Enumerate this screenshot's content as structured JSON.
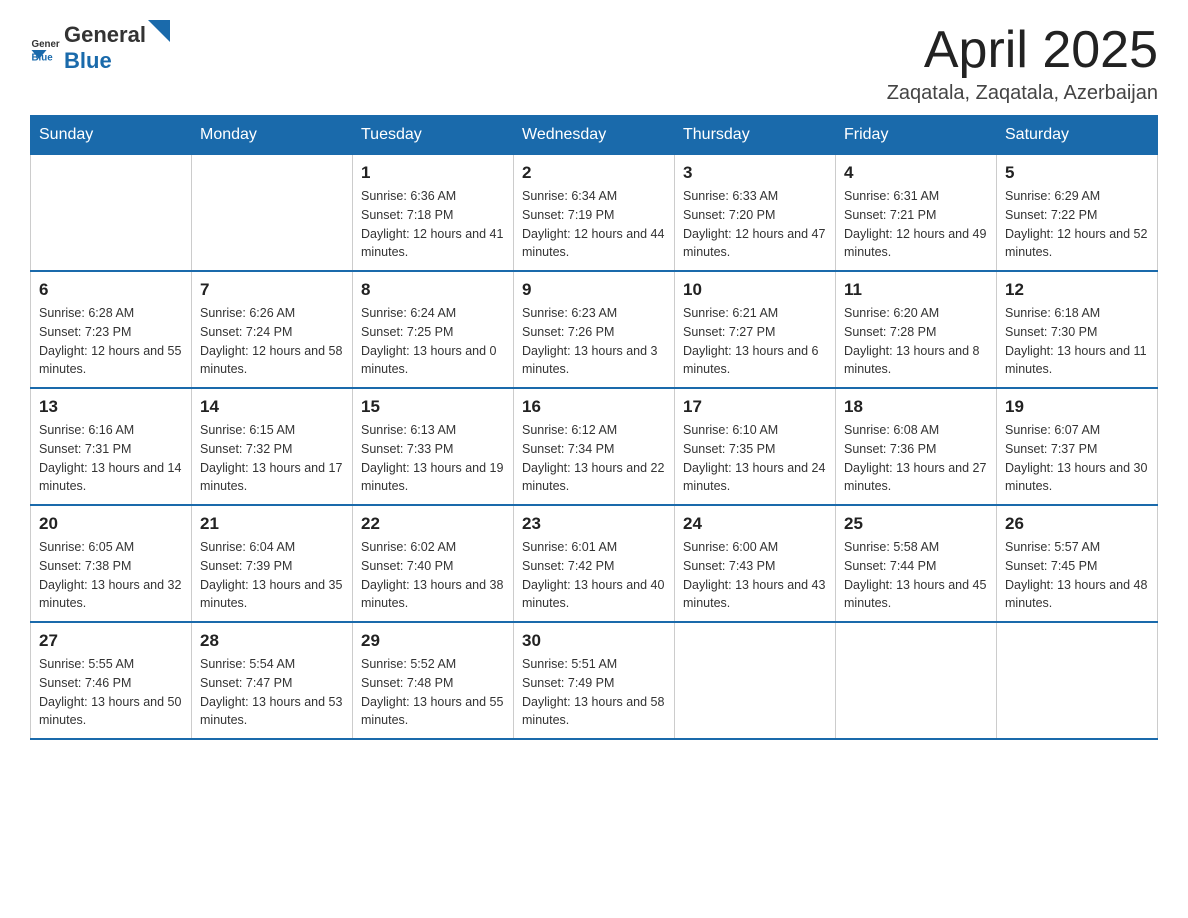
{
  "header": {
    "logo": {
      "general": "General",
      "blue": "Blue"
    },
    "title": "April 2025",
    "location": "Zaqatala, Zaqatala, Azerbaijan"
  },
  "days_of_week": [
    "Sunday",
    "Monday",
    "Tuesday",
    "Wednesday",
    "Thursday",
    "Friday",
    "Saturday"
  ],
  "weeks": [
    [
      {
        "day": "",
        "sunrise": "",
        "sunset": "",
        "daylight": ""
      },
      {
        "day": "",
        "sunrise": "",
        "sunset": "",
        "daylight": ""
      },
      {
        "day": "1",
        "sunrise": "Sunrise: 6:36 AM",
        "sunset": "Sunset: 7:18 PM",
        "daylight": "Daylight: 12 hours and 41 minutes."
      },
      {
        "day": "2",
        "sunrise": "Sunrise: 6:34 AM",
        "sunset": "Sunset: 7:19 PM",
        "daylight": "Daylight: 12 hours and 44 minutes."
      },
      {
        "day": "3",
        "sunrise": "Sunrise: 6:33 AM",
        "sunset": "Sunset: 7:20 PM",
        "daylight": "Daylight: 12 hours and 47 minutes."
      },
      {
        "day": "4",
        "sunrise": "Sunrise: 6:31 AM",
        "sunset": "Sunset: 7:21 PM",
        "daylight": "Daylight: 12 hours and 49 minutes."
      },
      {
        "day": "5",
        "sunrise": "Sunrise: 6:29 AM",
        "sunset": "Sunset: 7:22 PM",
        "daylight": "Daylight: 12 hours and 52 minutes."
      }
    ],
    [
      {
        "day": "6",
        "sunrise": "Sunrise: 6:28 AM",
        "sunset": "Sunset: 7:23 PM",
        "daylight": "Daylight: 12 hours and 55 minutes."
      },
      {
        "day": "7",
        "sunrise": "Sunrise: 6:26 AM",
        "sunset": "Sunset: 7:24 PM",
        "daylight": "Daylight: 12 hours and 58 minutes."
      },
      {
        "day": "8",
        "sunrise": "Sunrise: 6:24 AM",
        "sunset": "Sunset: 7:25 PM",
        "daylight": "Daylight: 13 hours and 0 minutes."
      },
      {
        "day": "9",
        "sunrise": "Sunrise: 6:23 AM",
        "sunset": "Sunset: 7:26 PM",
        "daylight": "Daylight: 13 hours and 3 minutes."
      },
      {
        "day": "10",
        "sunrise": "Sunrise: 6:21 AM",
        "sunset": "Sunset: 7:27 PM",
        "daylight": "Daylight: 13 hours and 6 minutes."
      },
      {
        "day": "11",
        "sunrise": "Sunrise: 6:20 AM",
        "sunset": "Sunset: 7:28 PM",
        "daylight": "Daylight: 13 hours and 8 minutes."
      },
      {
        "day": "12",
        "sunrise": "Sunrise: 6:18 AM",
        "sunset": "Sunset: 7:30 PM",
        "daylight": "Daylight: 13 hours and 11 minutes."
      }
    ],
    [
      {
        "day": "13",
        "sunrise": "Sunrise: 6:16 AM",
        "sunset": "Sunset: 7:31 PM",
        "daylight": "Daylight: 13 hours and 14 minutes."
      },
      {
        "day": "14",
        "sunrise": "Sunrise: 6:15 AM",
        "sunset": "Sunset: 7:32 PM",
        "daylight": "Daylight: 13 hours and 17 minutes."
      },
      {
        "day": "15",
        "sunrise": "Sunrise: 6:13 AM",
        "sunset": "Sunset: 7:33 PM",
        "daylight": "Daylight: 13 hours and 19 minutes."
      },
      {
        "day": "16",
        "sunrise": "Sunrise: 6:12 AM",
        "sunset": "Sunset: 7:34 PM",
        "daylight": "Daylight: 13 hours and 22 minutes."
      },
      {
        "day": "17",
        "sunrise": "Sunrise: 6:10 AM",
        "sunset": "Sunset: 7:35 PM",
        "daylight": "Daylight: 13 hours and 24 minutes."
      },
      {
        "day": "18",
        "sunrise": "Sunrise: 6:08 AM",
        "sunset": "Sunset: 7:36 PM",
        "daylight": "Daylight: 13 hours and 27 minutes."
      },
      {
        "day": "19",
        "sunrise": "Sunrise: 6:07 AM",
        "sunset": "Sunset: 7:37 PM",
        "daylight": "Daylight: 13 hours and 30 minutes."
      }
    ],
    [
      {
        "day": "20",
        "sunrise": "Sunrise: 6:05 AM",
        "sunset": "Sunset: 7:38 PM",
        "daylight": "Daylight: 13 hours and 32 minutes."
      },
      {
        "day": "21",
        "sunrise": "Sunrise: 6:04 AM",
        "sunset": "Sunset: 7:39 PM",
        "daylight": "Daylight: 13 hours and 35 minutes."
      },
      {
        "day": "22",
        "sunrise": "Sunrise: 6:02 AM",
        "sunset": "Sunset: 7:40 PM",
        "daylight": "Daylight: 13 hours and 38 minutes."
      },
      {
        "day": "23",
        "sunrise": "Sunrise: 6:01 AM",
        "sunset": "Sunset: 7:42 PM",
        "daylight": "Daylight: 13 hours and 40 minutes."
      },
      {
        "day": "24",
        "sunrise": "Sunrise: 6:00 AM",
        "sunset": "Sunset: 7:43 PM",
        "daylight": "Daylight: 13 hours and 43 minutes."
      },
      {
        "day": "25",
        "sunrise": "Sunrise: 5:58 AM",
        "sunset": "Sunset: 7:44 PM",
        "daylight": "Daylight: 13 hours and 45 minutes."
      },
      {
        "day": "26",
        "sunrise": "Sunrise: 5:57 AM",
        "sunset": "Sunset: 7:45 PM",
        "daylight": "Daylight: 13 hours and 48 minutes."
      }
    ],
    [
      {
        "day": "27",
        "sunrise": "Sunrise: 5:55 AM",
        "sunset": "Sunset: 7:46 PM",
        "daylight": "Daylight: 13 hours and 50 minutes."
      },
      {
        "day": "28",
        "sunrise": "Sunrise: 5:54 AM",
        "sunset": "Sunset: 7:47 PM",
        "daylight": "Daylight: 13 hours and 53 minutes."
      },
      {
        "day": "29",
        "sunrise": "Sunrise: 5:52 AM",
        "sunset": "Sunset: 7:48 PM",
        "daylight": "Daylight: 13 hours and 55 minutes."
      },
      {
        "day": "30",
        "sunrise": "Sunrise: 5:51 AM",
        "sunset": "Sunset: 7:49 PM",
        "daylight": "Daylight: 13 hours and 58 minutes."
      },
      {
        "day": "",
        "sunrise": "",
        "sunset": "",
        "daylight": ""
      },
      {
        "day": "",
        "sunrise": "",
        "sunset": "",
        "daylight": ""
      },
      {
        "day": "",
        "sunrise": "",
        "sunset": "",
        "daylight": ""
      }
    ]
  ]
}
